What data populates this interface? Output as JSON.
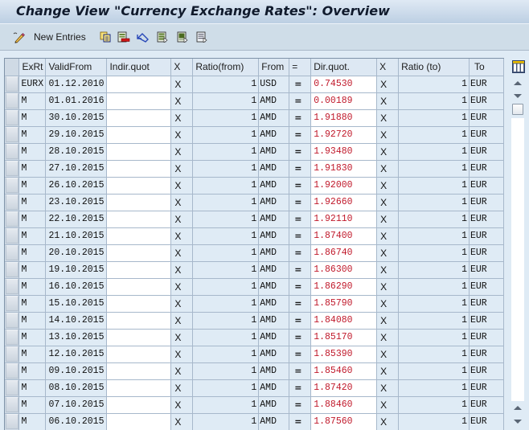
{
  "window": {
    "title": "Change View \"Currency Exchange Rates\": Overview"
  },
  "toolbar": {
    "new_entries_label": "New Entries",
    "buttons": [
      {
        "icon": "new-entries-pencil-icon"
      },
      {
        "icon": "copy-icon"
      },
      {
        "icon": "delete-icon"
      },
      {
        "icon": "undo-change-icon"
      },
      {
        "icon": "select-all-icon"
      },
      {
        "icon": "select-block-icon"
      },
      {
        "icon": "deselect-all-icon"
      }
    ]
  },
  "table": {
    "columns": [
      "ExRt",
      "ValidFrom",
      "Indir.quot",
      "X",
      "Ratio(from)",
      "From",
      "=",
      "Dir.quot.",
      "X",
      "Ratio (to)",
      "To"
    ],
    "rows": [
      {
        "exrt": "EURX",
        "valid_from": "01.12.2010",
        "indir": "",
        "x1": "X",
        "ratio_from": "1",
        "from": "USD",
        "eq": "=",
        "dir": "0.74530",
        "x2": "X",
        "ratio_to": "1",
        "to": "EUR"
      },
      {
        "exrt": "M",
        "valid_from": "01.01.2016",
        "indir": "",
        "x1": "X",
        "ratio_from": "1",
        "from": "AMD",
        "eq": "=",
        "dir": "0.00189",
        "x2": "X",
        "ratio_to": "1",
        "to": "EUR"
      },
      {
        "exrt": "M",
        "valid_from": "30.10.2015",
        "indir": "",
        "x1": "X",
        "ratio_from": "1",
        "from": "AMD",
        "eq": "=",
        "dir": "1.91880",
        "x2": "X",
        "ratio_to": "1",
        "to": "EUR"
      },
      {
        "exrt": "M",
        "valid_from": "29.10.2015",
        "indir": "",
        "x1": "X",
        "ratio_from": "1",
        "from": "AMD",
        "eq": "=",
        "dir": "1.92720",
        "x2": "X",
        "ratio_to": "1",
        "to": "EUR"
      },
      {
        "exrt": "M",
        "valid_from": "28.10.2015",
        "indir": "",
        "x1": "X",
        "ratio_from": "1",
        "from": "AMD",
        "eq": "=",
        "dir": "1.93480",
        "x2": "X",
        "ratio_to": "1",
        "to": "EUR"
      },
      {
        "exrt": "M",
        "valid_from": "27.10.2015",
        "indir": "",
        "x1": "X",
        "ratio_from": "1",
        "from": "AMD",
        "eq": "=",
        "dir": "1.91830",
        "x2": "X",
        "ratio_to": "1",
        "to": "EUR"
      },
      {
        "exrt": "M",
        "valid_from": "26.10.2015",
        "indir": "",
        "x1": "X",
        "ratio_from": "1",
        "from": "AMD",
        "eq": "=",
        "dir": "1.92000",
        "x2": "X",
        "ratio_to": "1",
        "to": "EUR"
      },
      {
        "exrt": "M",
        "valid_from": "23.10.2015",
        "indir": "",
        "x1": "X",
        "ratio_from": "1",
        "from": "AMD",
        "eq": "=",
        "dir": "1.92660",
        "x2": "X",
        "ratio_to": "1",
        "to": "EUR"
      },
      {
        "exrt": "M",
        "valid_from": "22.10.2015",
        "indir": "",
        "x1": "X",
        "ratio_from": "1",
        "from": "AMD",
        "eq": "=",
        "dir": "1.92110",
        "x2": "X",
        "ratio_to": "1",
        "to": "EUR"
      },
      {
        "exrt": "M",
        "valid_from": "21.10.2015",
        "indir": "",
        "x1": "X",
        "ratio_from": "1",
        "from": "AMD",
        "eq": "=",
        "dir": "1.87400",
        "x2": "X",
        "ratio_to": "1",
        "to": "EUR"
      },
      {
        "exrt": "M",
        "valid_from": "20.10.2015",
        "indir": "",
        "x1": "X",
        "ratio_from": "1",
        "from": "AMD",
        "eq": "=",
        "dir": "1.86740",
        "x2": "X",
        "ratio_to": "1",
        "to": "EUR"
      },
      {
        "exrt": "M",
        "valid_from": "19.10.2015",
        "indir": "",
        "x1": "X",
        "ratio_from": "1",
        "from": "AMD",
        "eq": "=",
        "dir": "1.86300",
        "x2": "X",
        "ratio_to": "1",
        "to": "EUR"
      },
      {
        "exrt": "M",
        "valid_from": "16.10.2015",
        "indir": "",
        "x1": "X",
        "ratio_from": "1",
        "from": "AMD",
        "eq": "=",
        "dir": "1.86290",
        "x2": "X",
        "ratio_to": "1",
        "to": "EUR"
      },
      {
        "exrt": "M",
        "valid_from": "15.10.2015",
        "indir": "",
        "x1": "X",
        "ratio_from": "1",
        "from": "AMD",
        "eq": "=",
        "dir": "1.85790",
        "x2": "X",
        "ratio_to": "1",
        "to": "EUR"
      },
      {
        "exrt": "M",
        "valid_from": "14.10.2015",
        "indir": "",
        "x1": "X",
        "ratio_from": "1",
        "from": "AMD",
        "eq": "=",
        "dir": "1.84080",
        "x2": "X",
        "ratio_to": "1",
        "to": "EUR"
      },
      {
        "exrt": "M",
        "valid_from": "13.10.2015",
        "indir": "",
        "x1": "X",
        "ratio_from": "1",
        "from": "AMD",
        "eq": "=",
        "dir": "1.85170",
        "x2": "X",
        "ratio_to": "1",
        "to": "EUR"
      },
      {
        "exrt": "M",
        "valid_from": "12.10.2015",
        "indir": "",
        "x1": "X",
        "ratio_from": "1",
        "from": "AMD",
        "eq": "=",
        "dir": "1.85390",
        "x2": "X",
        "ratio_to": "1",
        "to": "EUR"
      },
      {
        "exrt": "M",
        "valid_from": "09.10.2015",
        "indir": "",
        "x1": "X",
        "ratio_from": "1",
        "from": "AMD",
        "eq": "=",
        "dir": "1.85460",
        "x2": "X",
        "ratio_to": "1",
        "to": "EUR"
      },
      {
        "exrt": "M",
        "valid_from": "08.10.2015",
        "indir": "",
        "x1": "X",
        "ratio_from": "1",
        "from": "AMD",
        "eq": "=",
        "dir": "1.87420",
        "x2": "X",
        "ratio_to": "1",
        "to": "EUR"
      },
      {
        "exrt": "M",
        "valid_from": "07.10.2015",
        "indir": "",
        "x1": "X",
        "ratio_from": "1",
        "from": "AMD",
        "eq": "=",
        "dir": "1.88460",
        "x2": "X",
        "ratio_to": "1",
        "to": "EUR"
      },
      {
        "exrt": "M",
        "valid_from": "06.10.2015",
        "indir": "",
        "x1": "X",
        "ratio_from": "1",
        "from": "AMD",
        "eq": "=",
        "dir": "1.87560",
        "x2": "X",
        "ratio_to": "1",
        "to": "EUR"
      }
    ]
  },
  "colors": {
    "dir_quote_text": "#c0182a",
    "grid_background": "#dfebf5",
    "title_text": "#101a2c"
  }
}
